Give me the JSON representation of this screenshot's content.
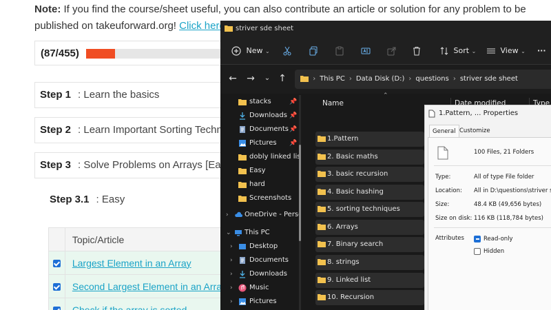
{
  "page": {
    "note_bold": "Note:",
    "note_text": " If you find the course/sheet useful, you can also contribute an article or solution for any problem to be published on takeuforward.org! ",
    "note_link": "Click here for more details",
    "note_end": ".",
    "progress": {
      "label": "(87/455)",
      "fraction": 0.191
    },
    "steps": [
      {
        "num": "Step 1",
        "title": ": Learn the basics"
      },
      {
        "num": "Step 2",
        "title": ": Learn Important Sorting Techniques"
      },
      {
        "num": "Step 3",
        "title": ": Solve Problems on Arrays [Easy -> Medium -> Hard]"
      }
    ],
    "substep": {
      "num": "Step 3.1",
      "title": ": Easy"
    },
    "table": {
      "header": "Topic/Article",
      "rows": [
        {
          "topic": "Largest Element in an Array",
          "done": true
        },
        {
          "topic": "Second Largest Element in an Array",
          "done": true
        },
        {
          "topic": "Check if the array is sorted",
          "done": true
        }
      ]
    }
  },
  "explorer": {
    "title": "striver sde sheet",
    "toolbar": {
      "new": "New",
      "sort": "Sort",
      "view": "View",
      "more": "···"
    },
    "address": [
      "This PC",
      "Data Disk (D:)",
      "questions",
      "striver sde sheet"
    ],
    "quick_access": [
      "stacks",
      "Downloads",
      "Documents",
      "Pictures",
      "dobly linked list",
      "Easy",
      "hard",
      "Screenshots"
    ],
    "onedrive": "OneDrive - Person",
    "this_pc": "This PC",
    "this_pc_items": [
      "Desktop",
      "Documents",
      "Downloads",
      "Music",
      "Pictures"
    ],
    "columns": {
      "name": "Name",
      "date": "Date modified",
      "type": "Type"
    },
    "folders": [
      "1.Pattern",
      "2. Basic maths",
      "3. basic recursion",
      "4. Basic hashing",
      "5. sorting techniques",
      "6. Arrays",
      "7. Binary search",
      "8. strings",
      "9. Linked list",
      "10. Recursion"
    ]
  },
  "properties": {
    "title": "1.Pattern, ... Properties",
    "tabs": [
      "General",
      "Customize"
    ],
    "summary": "100 Files, 21 Folders",
    "rows": [
      {
        "label": "Type:",
        "value": "All of type File folder"
      },
      {
        "label": "Location:",
        "value": "All in D:\\questions\\striver sde sheet"
      },
      {
        "label": "Size:",
        "value": "48.4 KB (49,656 bytes)"
      },
      {
        "label": "Size on disk:",
        "value": "116 KB (118,784 bytes)"
      }
    ],
    "attributes_label": "Attributes",
    "readonly_label": "Read-only",
    "hidden_label": "Hidden"
  },
  "colors": {
    "accent": "#f04d23",
    "link": "#1aa3c7",
    "folder": "#f2c14e",
    "dark_bg": "#191919"
  }
}
